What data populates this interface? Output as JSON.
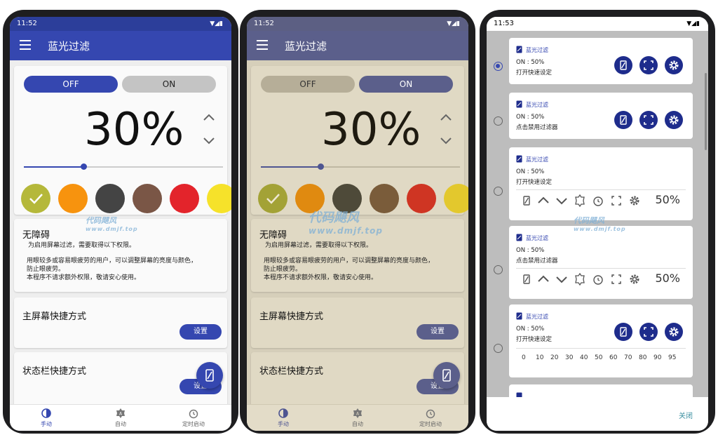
{
  "phone1": {
    "status_time": "11:52",
    "app_title": "蓝光过滤",
    "off_label": "OFF",
    "on_label": "ON",
    "percent_text": "30%",
    "slider_value": 0.3,
    "accessibility_title": "无障碍",
    "accessibility_line1": "为启用屏幕过滤，需要取得以下权限。",
    "accessibility_line2": "用眼较多或容易眼疲劳的用户，可以调整屏幕的亮度与颜色，",
    "accessibility_line3": "防止眼疲劳。",
    "accessibility_line4": "本程序不请求额外权限，敬请安心使用。",
    "home_shortcut_title": "主屏幕快捷方式",
    "home_shortcut_button": "设置",
    "statusbar_shortcut_title": "状态栏快捷方式",
    "statusbar_shortcut_button": "设置",
    "nav_manual": "手动",
    "nav_auto": "自动",
    "nav_timer": "定时启动",
    "swatch_colors": [
      "#b5b83a",
      "#f7930e",
      "#444444",
      "#7a5646",
      "#e3242b",
      "#f6e22a"
    ]
  },
  "phone2": {
    "status_time": "11:52",
    "app_title": "蓝光过滤",
    "off_label": "OFF",
    "on_label": "ON",
    "percent_text": "30%",
    "slider_value": 0.3,
    "accessibility_title": "无障碍",
    "accessibility_line1": "为启用屏幕过滤，需要取得以下权限。",
    "accessibility_line2": "用眼较多或容易眼疲劳的用户，可以调整屏幕的亮度与颜色，",
    "accessibility_line3": "防止眼疲劳。",
    "accessibility_line4": "本程序不请求额外权限，敬请安心使用。",
    "home_shortcut_title": "主屏幕快捷方式",
    "home_shortcut_button": "设置",
    "statusbar_shortcut_title": "状态栏快捷方式",
    "statusbar_shortcut_button": "设置",
    "nav_manual": "手动",
    "nav_auto": "自动",
    "nav_timer": "定时启动",
    "swatch_colors": [
      "#a3a236",
      "#e08a10",
      "#4e4a39",
      "#7a5c3a",
      "#cf3523",
      "#e3c82d"
    ]
  },
  "phone3": {
    "status_time": "11:53",
    "app_name": "蓝光过滤",
    "cards": [
      {
        "line1": "ON : 50%",
        "line2": "打开快速设定",
        "selected": true
      },
      {
        "line1": "ON : 50%",
        "line2": "点击禁用过滤器",
        "selected": false
      },
      {
        "line1": "ON : 50%",
        "line2": "打开快速设定",
        "selected": false,
        "percent": "50%"
      },
      {
        "line1": "ON : 50%",
        "line2": "点击禁用过滤器",
        "selected": false,
        "percent": "50%"
      },
      {
        "line1": "ON : 50%",
        "line2": "打开快速设定",
        "selected": false,
        "numbers": [
          "0",
          "10",
          "20",
          "30",
          "40",
          "50",
          "60",
          "70",
          "80",
          "90",
          "95"
        ]
      }
    ],
    "close_label": "关闭"
  },
  "watermark": {
    "main": "代码飓风",
    "sub": "www.dmjf.top"
  },
  "colors": {
    "primary": "#3547b0",
    "statusbar": "#2c3e9a",
    "dark_button": "#1e2c8c",
    "tint_background": "#e0d9c4"
  }
}
